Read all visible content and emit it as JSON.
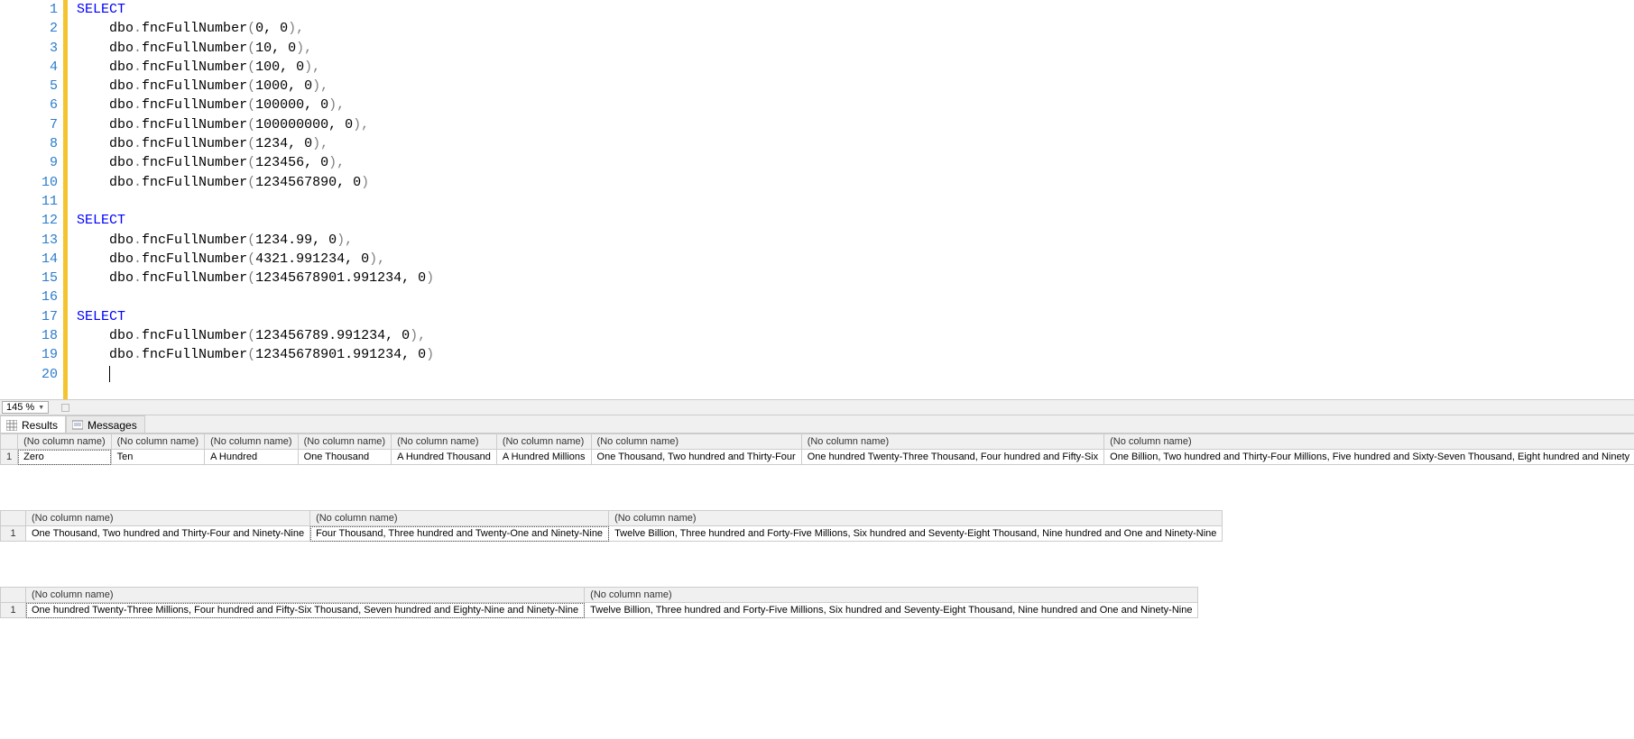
{
  "zoom": "145 %",
  "tabs": {
    "results": "Results",
    "messages": "Messages"
  },
  "editor": {
    "lines": [
      {
        "n": 1,
        "type": "keyword",
        "kw": "SELECT"
      },
      {
        "n": 2,
        "type": "call",
        "args": "0, 0",
        "comma": true
      },
      {
        "n": 3,
        "type": "call",
        "args": "10, 0",
        "comma": true
      },
      {
        "n": 4,
        "type": "call",
        "args": "100, 0",
        "comma": true
      },
      {
        "n": 5,
        "type": "call",
        "args": "1000, 0",
        "comma": true
      },
      {
        "n": 6,
        "type": "call",
        "args": "100000, 0",
        "comma": true
      },
      {
        "n": 7,
        "type": "call",
        "args": "100000000, 0",
        "comma": true
      },
      {
        "n": 8,
        "type": "call",
        "args": "1234, 0",
        "comma": true
      },
      {
        "n": 9,
        "type": "call",
        "args": "123456, 0",
        "comma": true
      },
      {
        "n": 10,
        "type": "call",
        "args": "1234567890, 0",
        "comma": false
      },
      {
        "n": 11,
        "type": "blank"
      },
      {
        "n": 12,
        "type": "keyword",
        "kw": "SELECT"
      },
      {
        "n": 13,
        "type": "call",
        "args": "1234.99, 0",
        "comma": true
      },
      {
        "n": 14,
        "type": "call",
        "args": "4321.991234, 0",
        "comma": true
      },
      {
        "n": 15,
        "type": "call",
        "args": "12345678901.991234, 0",
        "comma": false
      },
      {
        "n": 16,
        "type": "blank"
      },
      {
        "n": 17,
        "type": "keyword",
        "kw": "SELECT"
      },
      {
        "n": 18,
        "type": "call",
        "args": "123456789.991234, 0",
        "comma": true
      },
      {
        "n": 19,
        "type": "call",
        "args": "12345678901.991234, 0",
        "comma": false
      },
      {
        "n": 20,
        "type": "current"
      }
    ],
    "call_prefix": "dbo",
    "call_func": "fncFullNumber"
  },
  "column_header": "(No column name)",
  "grids": [
    {
      "row_num": "1",
      "selected_col": 0,
      "cells": [
        "Zero",
        "Ten",
        "A Hundred",
        "One Thousand",
        "A Hundred Thousand",
        "A Hundred Millions",
        "One Thousand, Two hundred and Thirty-Four",
        "One hundred Twenty-Three Thousand, Four hundred and Fifty-Six",
        "One Billion, Two hundred and Thirty-Four Millions, Five hundred and Sixty-Seven Thousand, Eight hundred and Ninety"
      ]
    },
    {
      "row_num": "1",
      "selected_col": 1,
      "cells": [
        "One Thousand, Two hundred and Thirty-Four and Ninety-Nine",
        "Four Thousand, Three hundred and Twenty-One and Ninety-Nine",
        "Twelve Billion, Three hundred and Forty-Five Millions, Six hundred and Seventy-Eight Thousand, Nine hundred and One and Ninety-Nine"
      ]
    },
    {
      "row_num": "1",
      "selected_col": 0,
      "cells": [
        "One hundred Twenty-Three Millions, Four hundred and Fifty-Six Thousand, Seven hundred and Eighty-Nine and Ninety-Nine",
        "Twelve Billion, Three hundred and Forty-Five Millions, Six hundred and Seventy-Eight Thousand, Nine hundred and One and Ninety-Nine"
      ]
    }
  ]
}
